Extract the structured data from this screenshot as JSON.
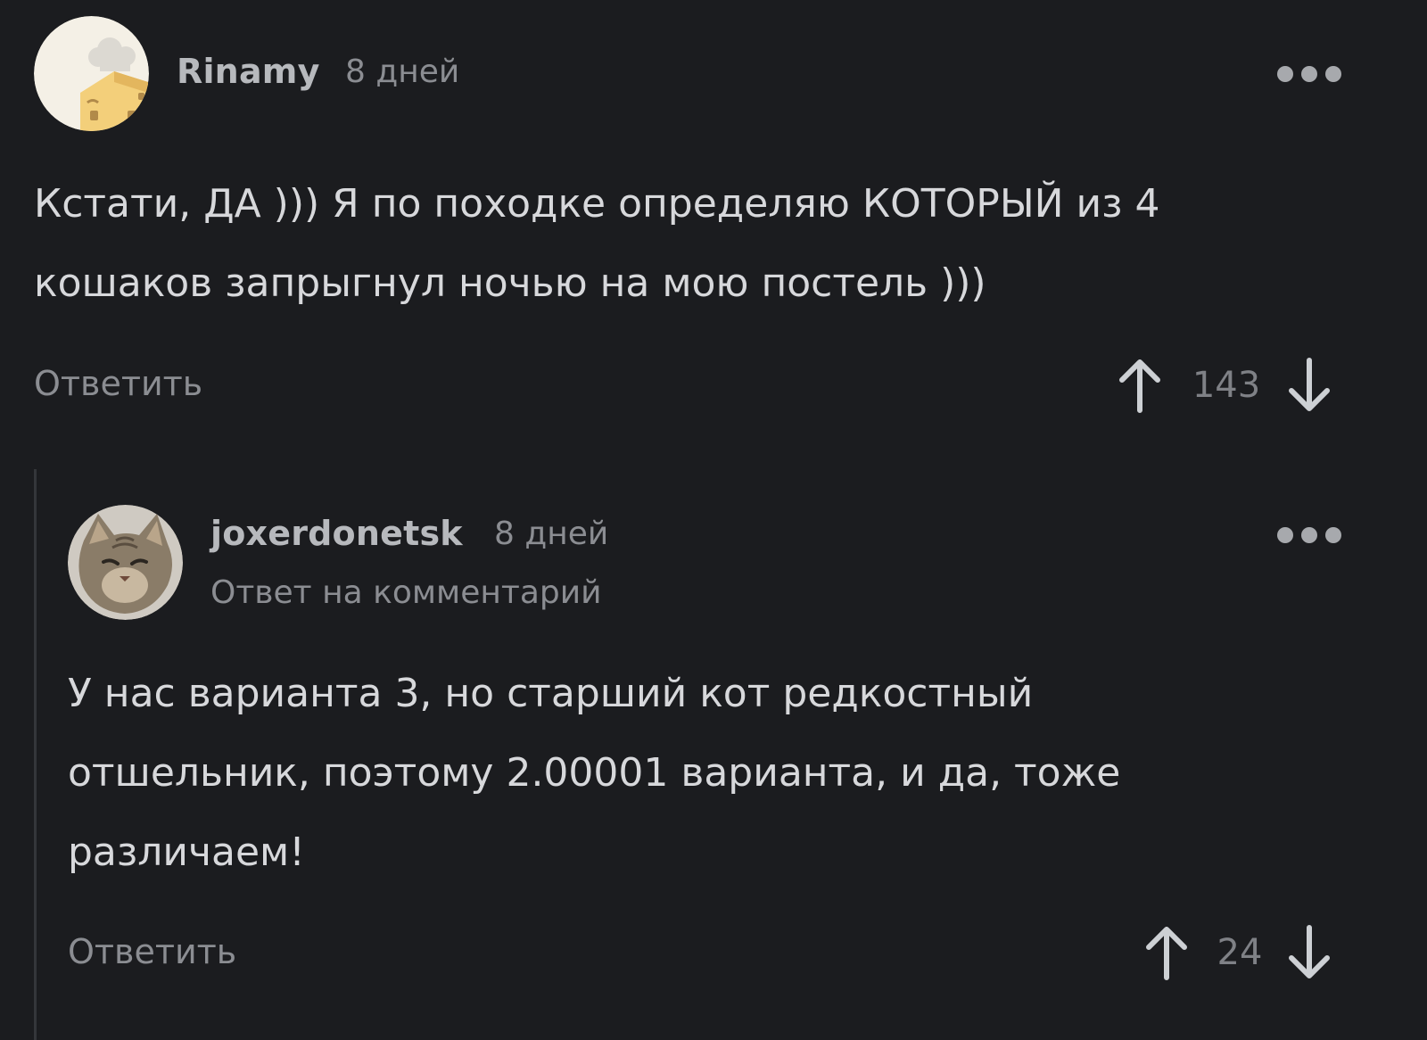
{
  "comments": [
    {
      "author": "Rinamy",
      "time": "8 дней",
      "text_lines": [
        "Кстати, ДА ))) Я по походке определяю КОТОРЫЙ из 4",
        "кошаков запрыгнул ночью на мою постель )))"
      ],
      "reply_label": "Ответить",
      "rating": "143",
      "avatar_icon": "chef-hat-house-avatar"
    },
    {
      "author": "joxerdonetsk",
      "time": "8 дней",
      "reply_to": "Ответ на комментарий",
      "text_lines": [
        "У нас варианта 3, но старший кот редкостный",
        "отшельник, поэтому 2.00001 варианта, и да, тоже",
        "различаем!"
      ],
      "reply_label": "Ответить",
      "rating": "24",
      "avatar_icon": "cat-photo-avatar"
    }
  ],
  "colors": {
    "background": "#1b1c1f",
    "text": "#d7d8db",
    "muted": "#8b8d92"
  }
}
